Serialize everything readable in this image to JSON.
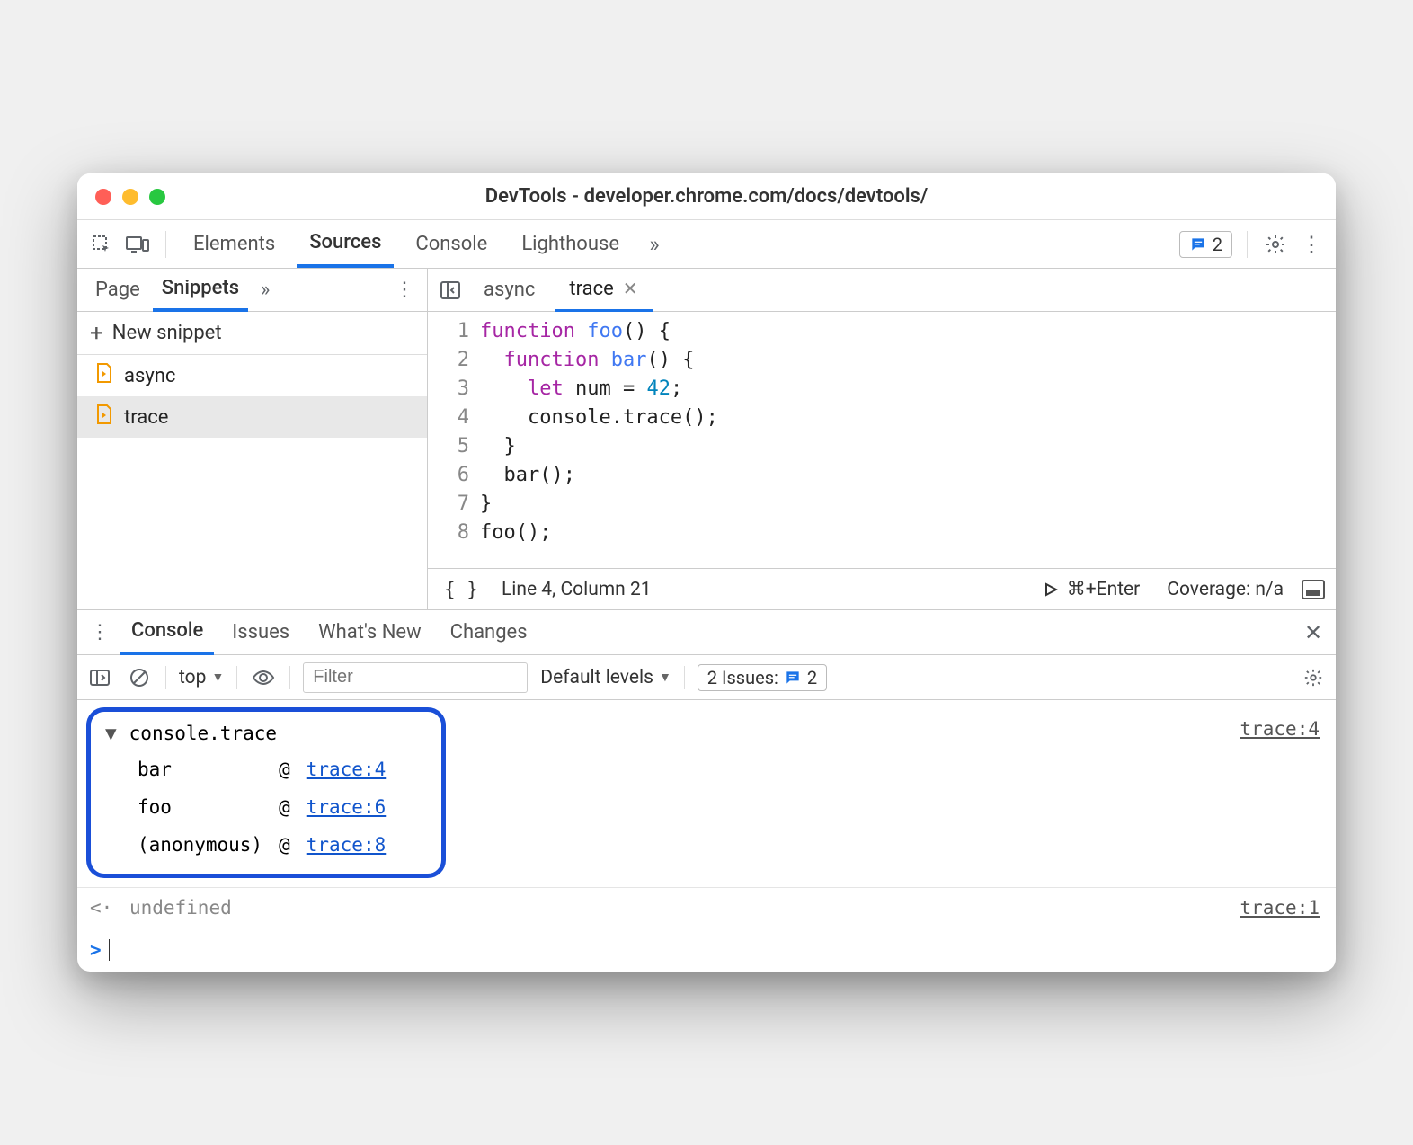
{
  "window": {
    "title": "DevTools - developer.chrome.com/docs/devtools/"
  },
  "mainTabs": {
    "elements": "Elements",
    "sources": "Sources",
    "console": "Console",
    "lighthouse": "Lighthouse"
  },
  "issuesBadge": "2",
  "sidebar": {
    "tabs": {
      "page": "Page",
      "snippets": "Snippets"
    },
    "newSnippet": "New snippet",
    "files": [
      "async",
      "trace"
    ]
  },
  "editor": {
    "tabs": [
      "async",
      "trace"
    ],
    "activeTab": "trace",
    "lines": [
      1,
      2,
      3,
      4,
      5,
      6,
      7,
      8
    ],
    "code": {
      "l1a": "function",
      "l1b": "foo",
      "l1c": "() {",
      "l2a": "function",
      "l2b": "bar",
      "l2c": "() {",
      "l3a": "let",
      "l3b": "num = ",
      "l3c": "42",
      "l3d": ";",
      "l4": "    console.trace();",
      "l5": "  }",
      "l6": "  bar();",
      "l7": "}",
      "l8": "foo();"
    },
    "status": {
      "pos": "Line 4, Column 21",
      "run": "⌘+Enter",
      "coverage": "Coverage: n/a"
    }
  },
  "drawer": {
    "tabs": {
      "console": "Console",
      "issues": "Issues",
      "whatsnew": "What's New",
      "changes": "Changes"
    }
  },
  "consoleToolbar": {
    "context": "top",
    "filterPlaceholder": "Filter",
    "levels": "Default levels",
    "issues": {
      "label": "2 Issues:",
      "count": "2"
    }
  },
  "consoleOutput": {
    "traceLabel": "console.trace",
    "sourceRight": "trace:4",
    "stack": [
      {
        "fn": "bar",
        "at": "@",
        "loc": "trace:4"
      },
      {
        "fn": "foo",
        "at": "@",
        "loc": "trace:6"
      },
      {
        "fn": "(anonymous)",
        "at": "@",
        "loc": "trace:8"
      }
    ],
    "return": {
      "value": "undefined",
      "src": "trace:1"
    }
  }
}
